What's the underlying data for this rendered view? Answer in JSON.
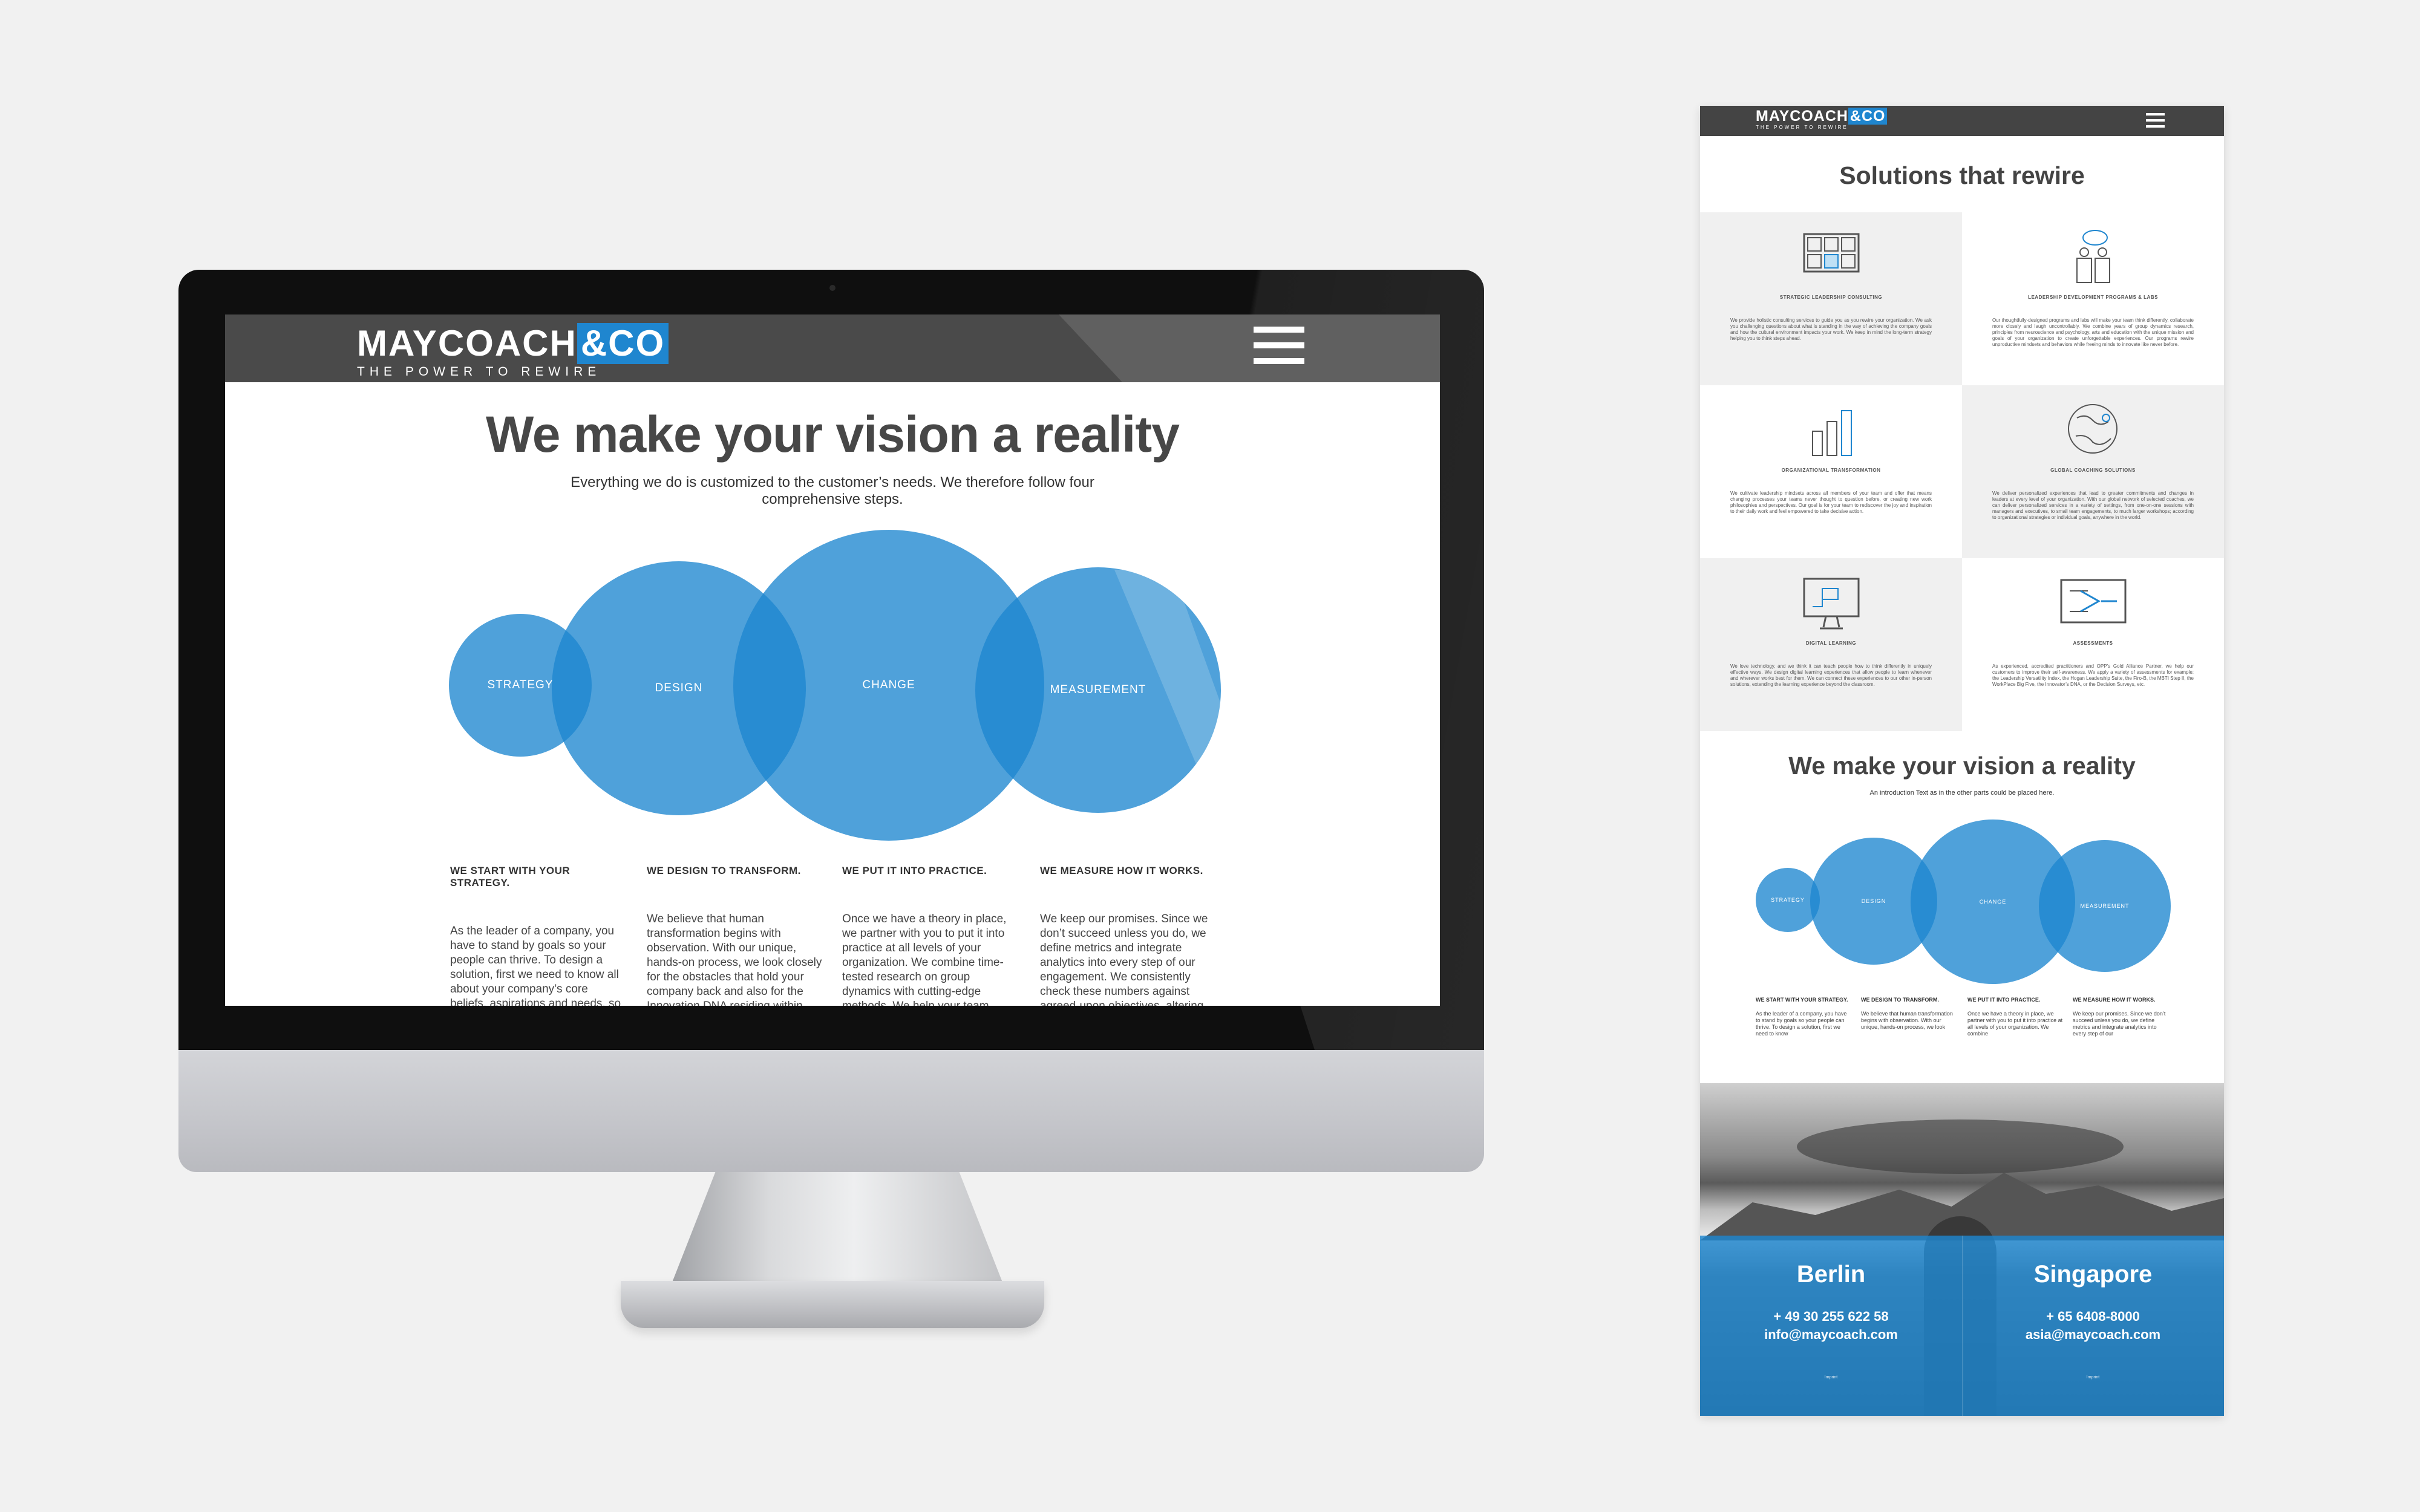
{
  "brand": {
    "logo_word": "MAYCOACH",
    "logo_amp": "&CO",
    "tagline": "THE POWER TO REWIRE",
    "accent_color": "#1f86cf",
    "header_color": "#4a4a4a"
  },
  "desktop": {
    "menu_icon": "hamburger-menu-icon",
    "title": "We make your vision a reality",
    "intro": "Everything we do is customized to the customer’s needs. We therefore follow four comprehensive steps.",
    "circles": [
      "STRATEGY",
      "DESIGN",
      "CHANGE",
      "MEASUREMENT"
    ],
    "steps": [
      {
        "heading": "WE START WITH YOUR STRATEGY.",
        "text": "As the leader of a company, you have to stand by goals so your people can thrive. To design a solution, first we need to know all about your company’s core beliefs, aspirations and needs, so we start with a blank sheet of"
      },
      {
        "heading": "WE DESIGN TO TRANSFORM.",
        "text": "We believe that human transformation begins with observation. With our unique, hands-on process, we look closely for the obstacles that hold your company back and also for the Innovation DNA residing within"
      },
      {
        "heading": "WE PUT IT INTO PRACTICE.",
        "text": "Once we have a theory in place, we partner with you to put it into practice at all levels of your organization. We combine time-tested research on group dynamics with cutting-edge methods. We help your team overcome fears"
      },
      {
        "heading": "WE MEASURE HOW IT WORKS.",
        "text": "We keep our promises. Since we don’t succeed unless you do, we define metrics and integrate analytics into every step of our engagement. We consistently check these numbers against agreed-upon objectives, altering"
      }
    ]
  },
  "mobile": {
    "menu_icon": "hamburger-menu-icon",
    "solutions_title": "Solutions that rewire",
    "solutions": [
      {
        "icon": "grid-consulting-icon",
        "heading": "STRATEGIC LEADERSHIP CONSULTING",
        "text": "We provide holistic consulting services to guide you as you rewire your organization. We ask you challenging questions about what is standing in the way of achieving the company goals and how the cultural environment impacts your work. We keep in mind the long-term strategy helping you to think steps ahead."
      },
      {
        "icon": "people-speech-icon",
        "heading": "LEADERSHIP DEVELOPMENT PROGRAMS & LABS",
        "text": "Our thoughtfully-designed programs and labs will make your team think differently, collaborate more closely and laugh uncontrollably. We combine years of group dynamics research, principles from neuroscience and psychology, arts and education with the unique mission and goals of your organization to create unforgettable experiences. Our programs rewire unproductive mindsets and behaviors while freeing minds to innovate like never before."
      },
      {
        "icon": "bar-chart-icon",
        "heading": "ORGANIZATIONAL TRANSFORMATION",
        "text": "We cultivate leadership mindsets across all members of your team and offer that means changing processes your teams never thought to question before, or creating new work philosophies and perspectives. Our goal is for your team to rediscover the joy and inspiration to their daily work and feel empowered to take decisive action."
      },
      {
        "icon": "globe-icon",
        "heading": "GLOBAL COACHING SOLUTIONS",
        "text": "We deliver personalized experiences that lead to greater commitments and changes in leaders at every level of your organization. With our global network of selected coaches, we can deliver personalized services in a variety of settings, from one-on-one sessions with managers and executives, to small team engagements, to much larger workshops; according to organizational strategies or individual goals, anywhere in the world."
      },
      {
        "icon": "monitor-icon",
        "heading": "DIGITAL LEARNING",
        "text": "We love technology, and we think it can teach people how to think differently in uniquely effective ways. We design digital learning experiences that allow people to learn whenever and wherever works best for them. We can connect these experiences to our other in-person solutions, extending the learning experience beyond the classroom."
      },
      {
        "icon": "assessment-icon",
        "heading": "ASSESSMENTS",
        "text": "As experienced, accredited practitioners and OPP’s Gold Alliance Partner, we help our customers to improve their self-awareness. We apply a variety of assessments for example: the Leadership Versatility Index, the Hogan Leadership Suite, the Firo-B, the MBTI Step II, the WorkPlace Big Five, the Innovator’s DNA, or the Decision Surveys, etc."
      }
    ],
    "vision_title": "We make your vision a reality",
    "vision_intro": "An introduction Text as in the other parts could be placed here.",
    "circles": [
      "STRATEGY",
      "DESIGN",
      "CHANGE",
      "MEASUREMENT"
    ],
    "steps": [
      {
        "heading": "WE START WITH YOUR STRATEGY.",
        "text": "As the leader of a company, you have to stand by goals so your people can thrive. To design a solution, first we need to know"
      },
      {
        "heading": "WE DESIGN TO TRANSFORM.",
        "text": "We believe that human transformation begins with observation. With our unique, hands-on process, we look"
      },
      {
        "heading": "WE PUT IT INTO PRACTICE.",
        "text": "Once we have a theory in place, we partner with you to put it into practice at all levels of your organization. We combine"
      },
      {
        "heading": "WE MEASURE HOW IT WORKS.",
        "text": "We keep our promises. Since we don’t succeed unless you do, we define metrics and integrate analytics into every step of our"
      }
    ],
    "contacts": [
      {
        "city": "Berlin",
        "phone": "+ 49 30 255 622 58",
        "email": "info@maycoach.com",
        "imprint": "Imprint"
      },
      {
        "city": "Singapore",
        "phone": "+ 65 6408-8000",
        "email": "asia@maycoach.com",
        "imprint": "Imprint"
      }
    ]
  }
}
